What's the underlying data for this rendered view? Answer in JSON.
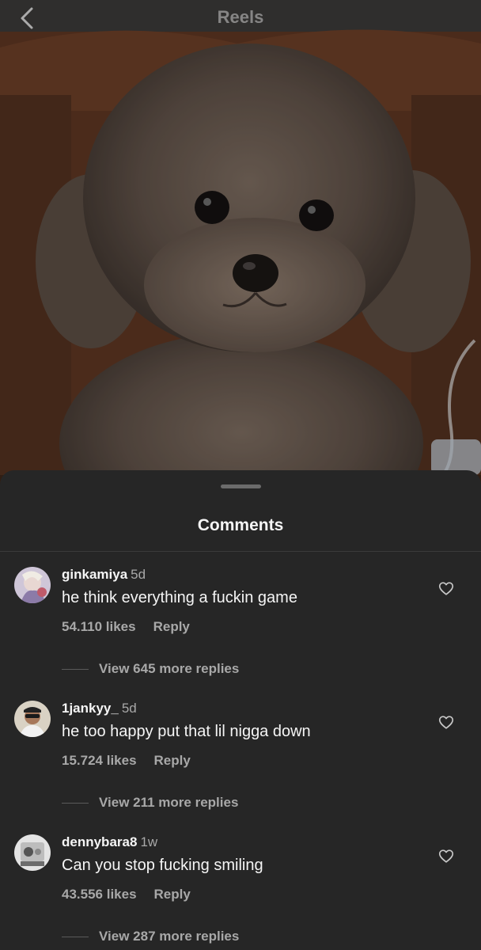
{
  "header": {
    "title": "Reels",
    "back_icon": "chevron-left-icon"
  },
  "comments_sheet": {
    "title": "Comments",
    "comments": [
      {
        "username": "ginkamiya",
        "time": "5d",
        "text": "he think everything a fuckin game",
        "likes": "54.110 likes",
        "reply_label": "Reply",
        "view_replies": "View 645 more replies"
      },
      {
        "username": "1jankyy_",
        "time": "5d",
        "text": "he too happy put that lil nigga down",
        "likes": "15.724 likes",
        "reply_label": "Reply",
        "view_replies": "View 211 more replies"
      },
      {
        "username": "dennybara8",
        "time": "1w",
        "text": "Can you stop fucking smiling",
        "likes": "43.556 likes",
        "reply_label": "Reply",
        "view_replies": "View 287 more replies"
      }
    ]
  },
  "icons": {
    "back": "chevron-left-icon",
    "like": "heart-outline-icon"
  },
  "colors": {
    "sheet_background": "#262626",
    "secondary_text": "#a8a8a8",
    "primary_text": "#f5f5f5"
  }
}
